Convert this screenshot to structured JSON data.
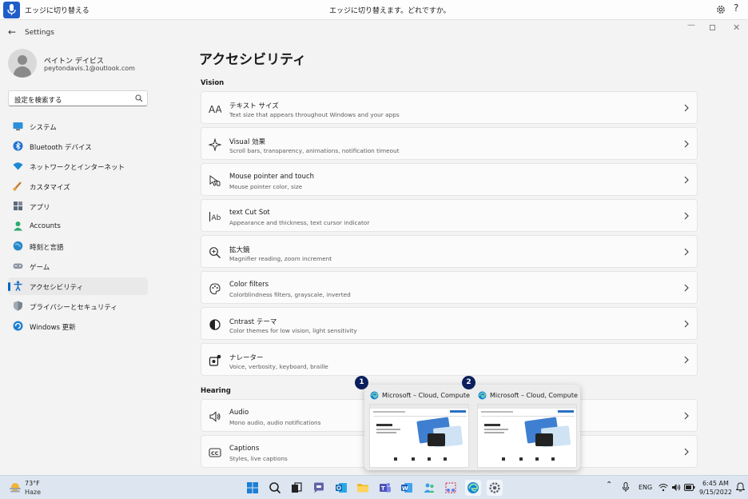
{
  "voice_bar": {
    "status": "エッジに切り替える",
    "prompt": "エッジに切り替えます。どれですか。"
  },
  "window": {
    "app_title": "Settings"
  },
  "profile": {
    "name": "ペイトン デイビス",
    "email": "peytondavis.1@outlook.com"
  },
  "search": {
    "value": "設定を検索する"
  },
  "sidebar": {
    "items": [
      {
        "label": "システム",
        "icon": "system-icon"
      },
      {
        "label": "Bluetooth デバイス",
        "icon": "bluetooth-icon"
      },
      {
        "label": "ネットワークとインターネット",
        "icon": "network-icon"
      },
      {
        "label": "カスタマイズ",
        "icon": "personalize-icon"
      },
      {
        "label": "アプリ",
        "icon": "apps-icon"
      },
      {
        "label": "Accounts",
        "icon": "accounts-icon"
      },
      {
        "label": "時刻と言語",
        "icon": "time-language-icon"
      },
      {
        "label": "ゲーム",
        "icon": "gaming-icon"
      },
      {
        "label": "アクセシビリティ",
        "icon": "accessibility-icon",
        "selected": true
      },
      {
        "label": "プライバシーとセキュリティ",
        "icon": "privacy-icon"
      },
      {
        "label": "Windows 更新",
        "icon": "windows-update-icon"
      }
    ]
  },
  "main": {
    "title": "アクセシビリティ",
    "sections": [
      {
        "heading": "Vision",
        "items": [
          {
            "title": "テキスト サイズ",
            "desc": "Text size that appears throughout Windows and your apps",
            "icon": "text-size-icon"
          },
          {
            "title": "Visual 効果",
            "desc": "Scroll bars, transparency, animations, notification timeout",
            "icon": "visual-effects-icon"
          },
          {
            "title": "Mouse pointer and touch",
            "desc": "Mouse pointer color, size",
            "icon": "mouse-pointer-icon"
          },
          {
            "title": "text Cut Sot",
            "desc": "Appearance and thickness, text cursor indicator",
            "icon": "text-cursor-icon"
          },
          {
            "title": "拡大鏡",
            "desc": "Magnifier reading, zoom increment",
            "icon": "magnifier-icon"
          },
          {
            "title": "Color filters",
            "desc": "Colorblindness filters, grayscale, inverted",
            "icon": "color-filters-icon"
          },
          {
            "title": "Cntrast テーマ",
            "desc": "Color themes for low vision, light sensitivity",
            "icon": "contrast-icon"
          },
          {
            "title": "ナレーター",
            "desc": "Voice, verbosity, keyboard, braille",
            "icon": "narrator-icon"
          }
        ]
      },
      {
        "heading": "Hearing",
        "items": [
          {
            "title": "Audio",
            "desc": "Mono audio, audio notifications",
            "icon": "audio-icon"
          },
          {
            "title": "Captions",
            "desc": "Styles, live captions",
            "icon": "captions-icon"
          }
        ]
      }
    ]
  },
  "task_popup": {
    "windows": [
      {
        "number": "1",
        "title": "Microsoft – Cloud, Computers, ..."
      },
      {
        "number": "2",
        "title": "Microsoft – Cloud, Computers, ..."
      }
    ]
  },
  "taskbar": {
    "weather_temp": "73°F",
    "weather_desc": "Haze",
    "language": "ENG",
    "time": "6:45 AM",
    "date": "9/15/2022"
  },
  "colors": {
    "accent": "#0067c0",
    "mic_button": "#1f5dc8",
    "badge": "#0b1f5c"
  }
}
